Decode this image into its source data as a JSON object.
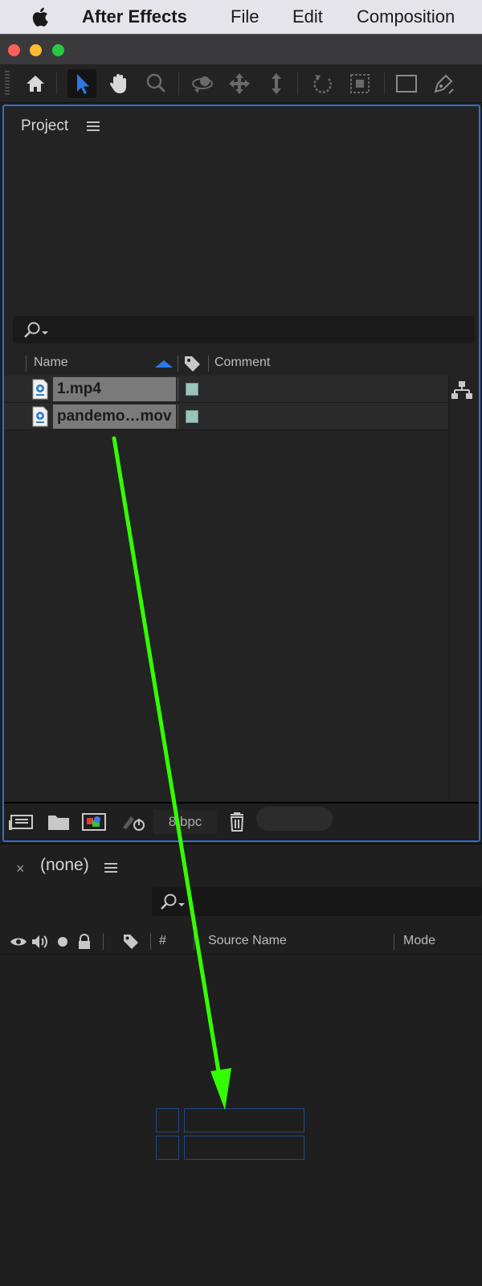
{
  "menubar": {
    "app_name": "After Effects",
    "items": [
      "File",
      "Edit",
      "Composition"
    ]
  },
  "toolbar": {
    "tools": [
      "home-icon",
      "selection-tool-icon",
      "hand-tool-icon",
      "zoom-tool-icon",
      "orbit-camera-icon",
      "pan-camera-icon",
      "dolly-camera-icon",
      "rotation-tool-icon",
      "pan-behind-icon",
      "rectangle-tool-icon",
      "pen-tool-icon"
    ],
    "active_tool": "selection-tool-icon",
    "accent_color": "#2d78e0"
  },
  "project": {
    "title": "Project",
    "columns": {
      "name": "Name",
      "comment": "Comment"
    },
    "items": [
      {
        "name": "1.mp4",
        "label_color": "#9ac3bb"
      },
      {
        "name": "pandemo…mov",
        "label_color": "#9ac3bb"
      }
    ],
    "bit_depth": "8 bpc"
  },
  "timeline": {
    "close_glyph": "×",
    "title": "(none)",
    "columns": {
      "number": "#",
      "source_name": "Source Name",
      "mode": "Mode"
    }
  },
  "annotation": {
    "arrow_color": "#33ff00"
  }
}
